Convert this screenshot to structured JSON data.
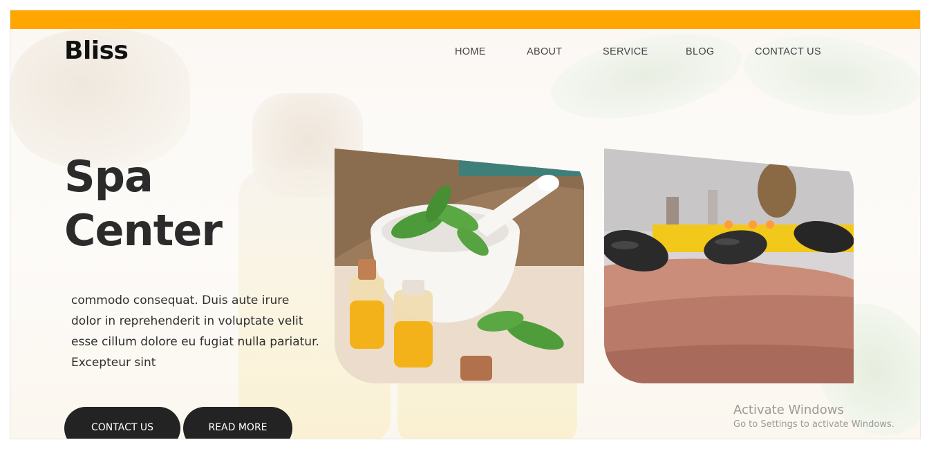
{
  "brand": {
    "logo": "Bliss",
    "accent_color": "#ffa600",
    "button_color": "#232323"
  },
  "nav": {
    "items": [
      {
        "label": "HOME"
      },
      {
        "label": "ABOUT"
      },
      {
        "label": "SERVICE"
      },
      {
        "label": "BLOG"
      },
      {
        "label": "CONTACT US"
      }
    ]
  },
  "hero": {
    "title_line1": "Spa",
    "title_line2": "Center",
    "description": "commodo consequat. Duis aute irure dolor in reprehenderit in voluptate velit esse cillum dolore eu fugiat nulla pariatur. Excepteur sint",
    "buttons": {
      "contact": "CONTACT US",
      "read_more": "READ MORE"
    }
  },
  "gallery": [
    {
      "icon": "herbs-mortar-oil-image"
    },
    {
      "icon": "hot-stone-massage-image"
    }
  ],
  "watermark": {
    "title": "Activate Windows",
    "subtitle": "Go to Settings to activate Windows."
  }
}
